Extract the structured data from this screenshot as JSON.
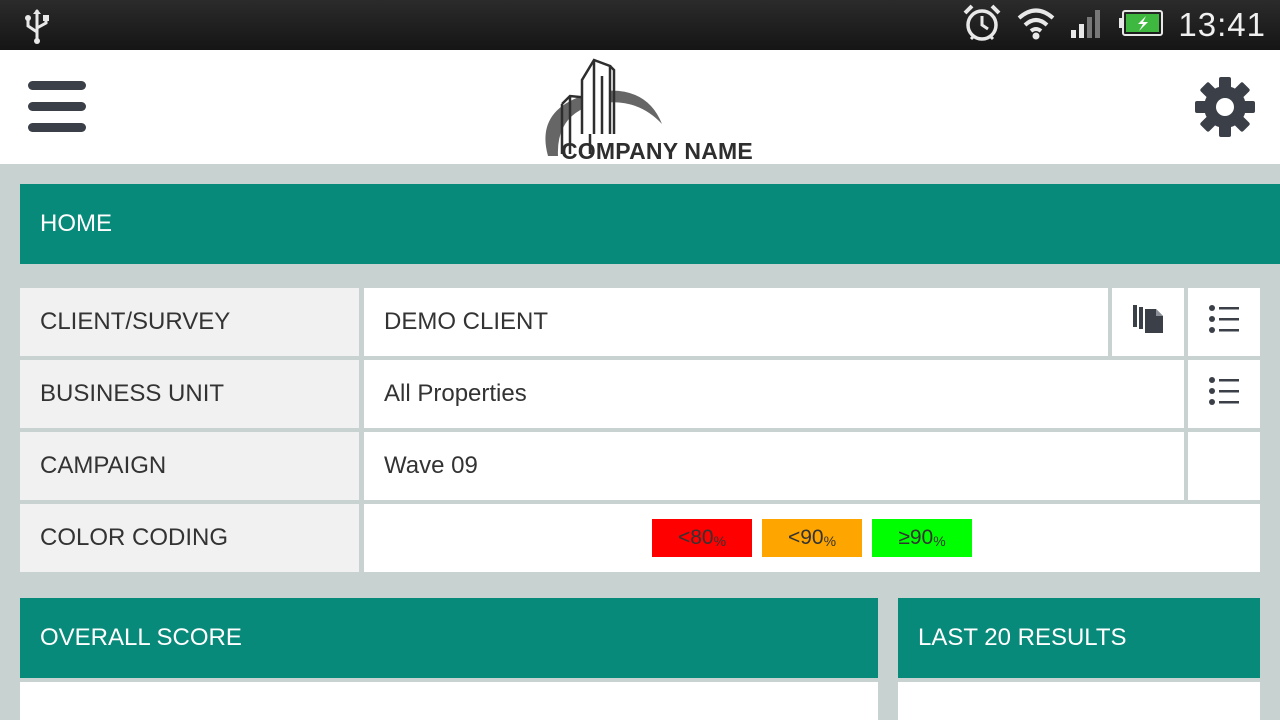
{
  "status_bar": {
    "time": "13:41",
    "icons": [
      "usb-icon",
      "alarm-icon",
      "wifi-icon",
      "signal-icon",
      "battery-charging-icon"
    ]
  },
  "header": {
    "logo_text": "COMPANY NAME",
    "icons": [
      "menu-icon",
      "gear-icon"
    ]
  },
  "home": {
    "title": "HOME",
    "rows": [
      {
        "label": "CLIENT/SURVEY",
        "value": "DEMO CLIENT"
      },
      {
        "label": "BUSINESS UNIT",
        "value": "All Properties"
      },
      {
        "label": "CAMPAIGN",
        "value": "Wave 09"
      },
      {
        "label": "COLOR CODING"
      }
    ],
    "color_coding": [
      {
        "label": "<80",
        "unit": "%",
        "color": "#ff0000"
      },
      {
        "label": "<90",
        "unit": "%",
        "color": "#ffa500"
      },
      {
        "label": "≥90",
        "unit": "%",
        "color": "#00ff00"
      }
    ]
  },
  "overall_score": {
    "title": "OVERALL SCORE"
  },
  "last_results": {
    "title": "LAST 20 RESULTS"
  },
  "colors": {
    "accent": "#088a7a",
    "background": "#c8d3d1"
  }
}
